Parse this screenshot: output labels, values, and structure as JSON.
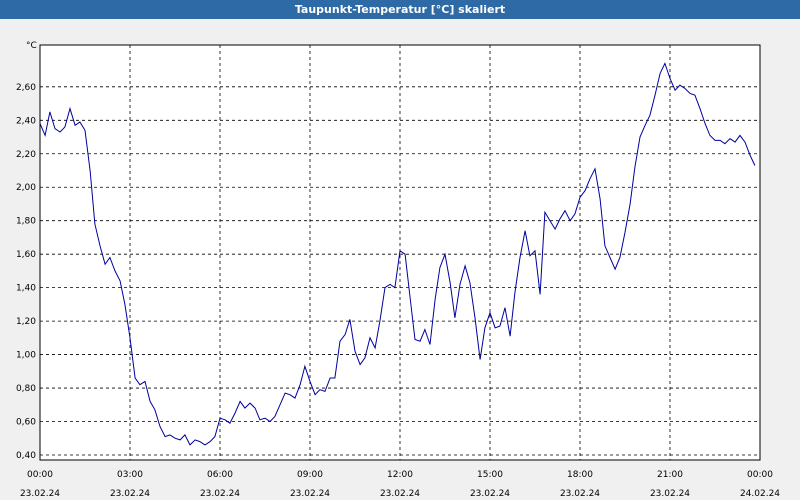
{
  "window": {
    "title": "Taupunkt-Temperatur [°C] skaliert"
  },
  "colors": {
    "line": "#0000a0",
    "grid": "#000000",
    "plot_bg": "#ffffff",
    "titlebar": "#2e6aa5"
  },
  "chart_data": {
    "type": "line",
    "title": "Taupunkt-Temperatur [°C] skaliert",
    "ylabel": "°C",
    "xlabel": "",
    "ylim": [
      0.37,
      2.85
    ],
    "xlim_hours": [
      0,
      24
    ],
    "grid": true,
    "y_ticks": [
      "0,40",
      "0,60",
      "0,80",
      "1,00",
      "1,20",
      "1,40",
      "1,60",
      "1,80",
      "2,00",
      "2,20",
      "2,40",
      "2,60"
    ],
    "x_ticks": [
      {
        "time": "00:00",
        "date": "23.02.24"
      },
      {
        "time": "03:00",
        "date": "23.02.24"
      },
      {
        "time": "06:00",
        "date": "23.02.24"
      },
      {
        "time": "09:00",
        "date": "23.02.24"
      },
      {
        "time": "12:00",
        "date": "23.02.24"
      },
      {
        "time": "15:00",
        "date": "23.02.24"
      },
      {
        "time": "18:00",
        "date": "23.02.24"
      },
      {
        "time": "21:00",
        "date": "23.02.24"
      },
      {
        "time": "00:00",
        "date": "24.02.24"
      }
    ],
    "series": [
      {
        "points": [
          [
            0.0,
            2.38
          ],
          [
            0.17,
            2.31
          ],
          [
            0.33,
            2.45
          ],
          [
            0.5,
            2.35
          ],
          [
            0.67,
            2.33
          ],
          [
            0.83,
            2.36
          ],
          [
            1.0,
            2.47
          ],
          [
            1.17,
            2.37
          ],
          [
            1.33,
            2.39
          ],
          [
            1.5,
            2.34
          ],
          [
            1.67,
            2.1
          ],
          [
            1.83,
            1.78
          ],
          [
            2.0,
            1.65
          ],
          [
            2.17,
            1.54
          ],
          [
            2.33,
            1.58
          ],
          [
            2.5,
            1.5
          ],
          [
            2.67,
            1.44
          ],
          [
            2.83,
            1.3
          ],
          [
            3.0,
            1.1
          ],
          [
            3.17,
            0.86
          ],
          [
            3.33,
            0.82
          ],
          [
            3.5,
            0.84
          ],
          [
            3.67,
            0.72
          ],
          [
            3.83,
            0.67
          ],
          [
            4.0,
            0.57
          ],
          [
            4.17,
            0.51
          ],
          [
            4.33,
            0.52
          ],
          [
            4.5,
            0.5
          ],
          [
            4.67,
            0.49
          ],
          [
            4.83,
            0.52
          ],
          [
            5.0,
            0.46
          ],
          [
            5.17,
            0.49
          ],
          [
            5.33,
            0.48
          ],
          [
            5.5,
            0.46
          ],
          [
            5.67,
            0.48
          ],
          [
            5.83,
            0.51
          ],
          [
            6.0,
            0.62
          ],
          [
            6.17,
            0.61
          ],
          [
            6.33,
            0.59
          ],
          [
            6.5,
            0.65
          ],
          [
            6.67,
            0.72
          ],
          [
            6.83,
            0.68
          ],
          [
            7.0,
            0.71
          ],
          [
            7.17,
            0.68
          ],
          [
            7.33,
            0.61
          ],
          [
            7.5,
            0.62
          ],
          [
            7.67,
            0.6
          ],
          [
            7.83,
            0.63
          ],
          [
            8.0,
            0.7
          ],
          [
            8.17,
            0.77
          ],
          [
            8.33,
            0.76
          ],
          [
            8.5,
            0.74
          ],
          [
            8.67,
            0.82
          ],
          [
            8.83,
            0.93
          ],
          [
            9.0,
            0.84
          ],
          [
            9.17,
            0.76
          ],
          [
            9.33,
            0.79
          ],
          [
            9.5,
            0.78
          ],
          [
            9.67,
            0.86
          ],
          [
            9.83,
            0.86
          ],
          [
            10.0,
            1.08
          ],
          [
            10.17,
            1.12
          ],
          [
            10.33,
            1.21
          ],
          [
            10.5,
            1.02
          ],
          [
            10.67,
            0.94
          ],
          [
            10.83,
            0.98
          ],
          [
            11.0,
            1.1
          ],
          [
            11.17,
            1.04
          ],
          [
            11.33,
            1.2
          ],
          [
            11.5,
            1.4
          ],
          [
            11.67,
            1.42
          ],
          [
            11.83,
            1.4
          ],
          [
            12.0,
            1.62
          ],
          [
            12.17,
            1.6
          ],
          [
            12.33,
            1.35
          ],
          [
            12.5,
            1.09
          ],
          [
            12.67,
            1.08
          ],
          [
            12.83,
            1.15
          ],
          [
            13.0,
            1.06
          ],
          [
            13.17,
            1.33
          ],
          [
            13.33,
            1.52
          ],
          [
            13.5,
            1.6
          ],
          [
            13.67,
            1.43
          ],
          [
            13.83,
            1.22
          ],
          [
            14.0,
            1.42
          ],
          [
            14.17,
            1.53
          ],
          [
            14.33,
            1.43
          ],
          [
            14.5,
            1.22
          ],
          [
            14.67,
            0.97
          ],
          [
            14.83,
            1.16
          ],
          [
            15.0,
            1.25
          ],
          [
            15.17,
            1.16
          ],
          [
            15.33,
            1.17
          ],
          [
            15.5,
            1.28
          ],
          [
            15.67,
            1.11
          ],
          [
            15.83,
            1.37
          ],
          [
            16.0,
            1.58
          ],
          [
            16.17,
            1.74
          ],
          [
            16.33,
            1.59
          ],
          [
            16.5,
            1.62
          ],
          [
            16.67,
            1.36
          ],
          [
            16.83,
            1.85
          ],
          [
            17.0,
            1.8
          ],
          [
            17.17,
            1.75
          ],
          [
            17.33,
            1.81
          ],
          [
            17.5,
            1.86
          ],
          [
            17.67,
            1.8
          ],
          [
            17.83,
            1.84
          ],
          [
            18.0,
            1.94
          ],
          [
            18.17,
            1.98
          ],
          [
            18.33,
            2.05
          ],
          [
            18.5,
            2.11
          ],
          [
            18.67,
            1.93
          ],
          [
            18.83,
            1.65
          ],
          [
            19.0,
            1.58
          ],
          [
            19.17,
            1.51
          ],
          [
            19.33,
            1.58
          ],
          [
            19.5,
            1.73
          ],
          [
            19.67,
            1.9
          ],
          [
            19.83,
            2.12
          ],
          [
            20.0,
            2.3
          ],
          [
            20.17,
            2.37
          ],
          [
            20.33,
            2.43
          ],
          [
            20.5,
            2.55
          ],
          [
            20.67,
            2.68
          ],
          [
            20.83,
            2.74
          ],
          [
            21.0,
            2.65
          ],
          [
            21.17,
            2.58
          ],
          [
            21.33,
            2.61
          ],
          [
            21.5,
            2.59
          ],
          [
            21.67,
            2.56
          ],
          [
            21.83,
            2.55
          ],
          [
            22.0,
            2.47
          ],
          [
            22.17,
            2.38
          ],
          [
            22.33,
            2.31
          ],
          [
            22.5,
            2.28
          ],
          [
            22.67,
            2.28
          ],
          [
            22.83,
            2.26
          ],
          [
            23.0,
            2.29
          ],
          [
            23.17,
            2.27
          ],
          [
            23.33,
            2.31
          ],
          [
            23.5,
            2.27
          ],
          [
            23.67,
            2.19
          ],
          [
            23.83,
            2.13
          ]
        ]
      }
    ]
  }
}
